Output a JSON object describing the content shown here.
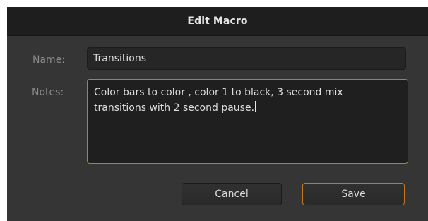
{
  "dialog": {
    "title": "Edit Macro",
    "name_label": "Name:",
    "name_value": "Transitions",
    "notes_label": "Notes:",
    "notes_value": "Color bars to color , color 1 to black, 3 second mix\ntransitions with 2 second pause.",
    "cancel_label": "Cancel",
    "save_label": "Save"
  },
  "colors": {
    "accent": "#c8781c",
    "dialog_bg": "#353535",
    "titlebar_bg": "#1e1e1e"
  }
}
